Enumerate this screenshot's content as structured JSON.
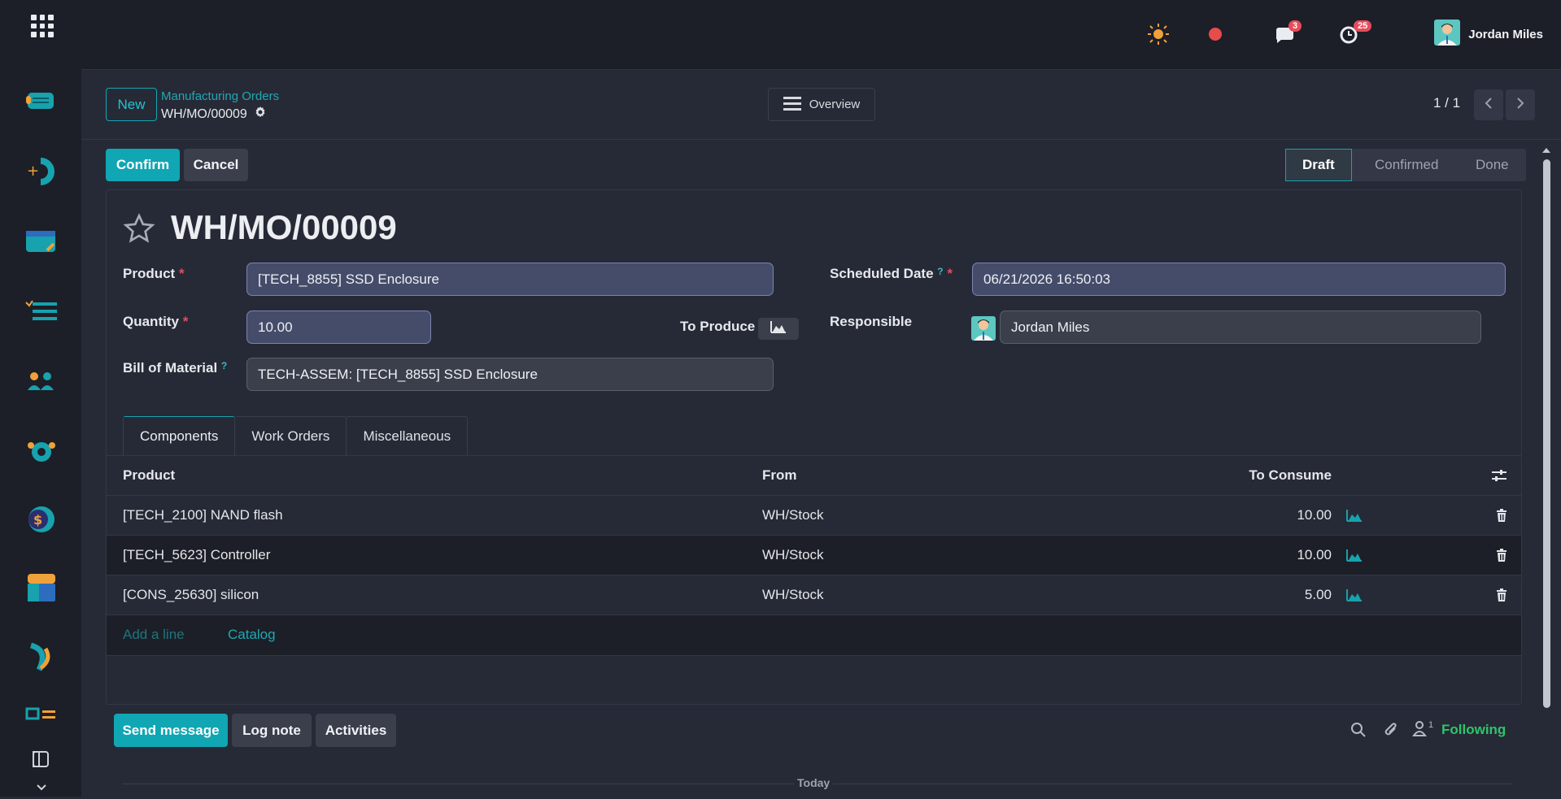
{
  "topbar": {
    "chat_badge": "3",
    "activity_badge": "25",
    "user_name": "Jordan Miles"
  },
  "control_panel": {
    "new_label": "New",
    "breadcrumb_parent": "Manufacturing Orders",
    "breadcrumb_current": "WH/MO/00009",
    "overview_label": "Overview",
    "pager": "1 / 1"
  },
  "statusbar": {
    "confirm_label": "Confirm",
    "cancel_label": "Cancel",
    "stages": [
      "Draft",
      "Confirmed",
      "Done"
    ],
    "active_stage": "Draft"
  },
  "form": {
    "title": "WH/MO/00009",
    "product_label": "Product",
    "product_value": "[TECH_8855] SSD Enclosure",
    "quantity_label": "Quantity",
    "quantity_value": "10.00",
    "to_produce_label": "To Produce",
    "bom_label": "Bill of Material",
    "bom_value": "TECH-ASSEM: [TECH_8855] SSD Enclosure",
    "scheduled_label": "Scheduled Date",
    "scheduled_value": "06/21/2026 16:50:03",
    "responsible_label": "Responsible",
    "responsible_value": "Jordan Miles"
  },
  "tabs": [
    "Components",
    "Work Orders",
    "Miscellaneous"
  ],
  "table": {
    "headers": {
      "product": "Product",
      "from": "From",
      "to_consume": "To Consume"
    },
    "rows": [
      {
        "product": "[TECH_2100] NAND flash",
        "from": "WH/Stock",
        "qty": "10.00"
      },
      {
        "product": "[TECH_5623] Controller",
        "from": "WH/Stock",
        "qty": "10.00"
      },
      {
        "product": "[CONS_25630] silicon",
        "from": "WH/Stock",
        "qty": "5.00"
      }
    ],
    "add_line": "Add a line",
    "catalog": "Catalog"
  },
  "chatter": {
    "send_label": "Send message",
    "log_label": "Log note",
    "activities_label": "Activities",
    "followers_count": "1",
    "following_label": "Following",
    "today_label": "Today"
  },
  "colors": {
    "accent": "#10a6b3",
    "danger": "#e74c5a",
    "following": "#2ec56a"
  }
}
